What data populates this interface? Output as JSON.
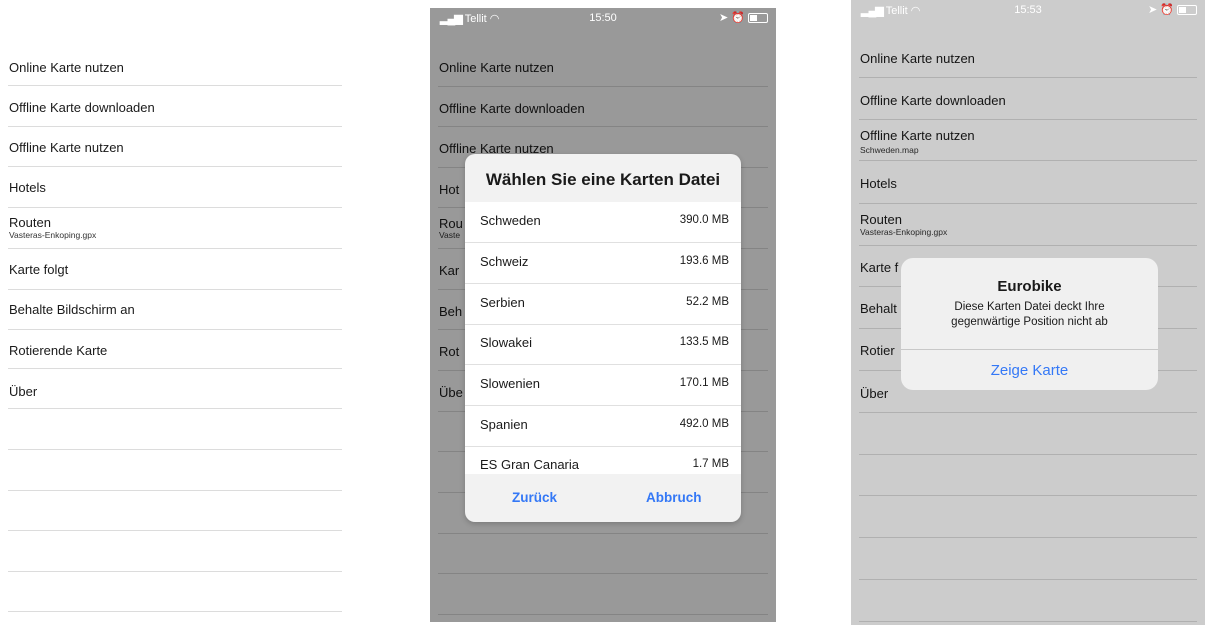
{
  "screen1": {
    "menu": [
      {
        "label": "Online Karte nutzen",
        "sub": ""
      },
      {
        "label": "Offline Karte downloaden",
        "sub": ""
      },
      {
        "label": "Offline Karte nutzen",
        "sub": ""
      },
      {
        "label": "Hotels",
        "sub": ""
      },
      {
        "label": "Routen",
        "sub": "Vasteras-Enkoping.gpx"
      },
      {
        "label": "Karte folgt",
        "sub": ""
      },
      {
        "label": "Behalte Bildschirm an",
        "sub": ""
      },
      {
        "label": "Rotierende Karte",
        "sub": ""
      },
      {
        "label": "Über",
        "sub": ""
      }
    ]
  },
  "screen2": {
    "status": {
      "carrier": "Tellit",
      "time": "15:50"
    },
    "menu": [
      {
        "label": "Online Karte nutzen",
        "sub": ""
      },
      {
        "label": "Offline Karte downloaden",
        "sub": ""
      },
      {
        "label": "Offline Karte nutzen",
        "sub": ""
      },
      {
        "label": "Hot",
        "sub": ""
      },
      {
        "label": "Rou",
        "sub": "Vaste"
      },
      {
        "label": "Kar",
        "sub": ""
      },
      {
        "label": "Beh",
        "sub": ""
      },
      {
        "label": "Rot",
        "sub": ""
      },
      {
        "label": "Übe",
        "sub": ""
      }
    ],
    "picker": {
      "title": "Wählen Sie eine Karten Datei",
      "items": [
        {
          "name": "Schweden",
          "size": "390.0 MB"
        },
        {
          "name": "Schweiz",
          "size": "193.6 MB"
        },
        {
          "name": "Serbien",
          "size": "52.2 MB"
        },
        {
          "name": "Slowakei",
          "size": "133.5 MB"
        },
        {
          "name": "Slowenien",
          "size": "170.1 MB"
        },
        {
          "name": "Spanien",
          "size": "492.0 MB"
        },
        {
          "name": "ES Gran Canaria",
          "size": "1.7 MB"
        }
      ],
      "back_label": "Zurück",
      "cancel_label": "Abbruch"
    }
  },
  "screen3": {
    "status": {
      "carrier": "Tellit",
      "time": "15:53"
    },
    "menu": [
      {
        "label": "Online Karte nutzen",
        "sub": ""
      },
      {
        "label": "Offline Karte downloaden",
        "sub": ""
      },
      {
        "label": "Offline Karte nutzen",
        "sub": "Schweden.map"
      },
      {
        "label": "Hotels",
        "sub": ""
      },
      {
        "label": "Routen",
        "sub": "Vasteras-Enkoping.gpx"
      },
      {
        "label": "Karte f",
        "sub": ""
      },
      {
        "label": "Behalt",
        "sub": ""
      },
      {
        "label": "Rotier",
        "sub": ""
      },
      {
        "label": "Über",
        "sub": ""
      }
    ],
    "alert": {
      "title": "Eurobike",
      "message_line1": "Diese Karten Datei deckt Ihre",
      "message_line2": "gegenwärtige Position nicht ab",
      "button": "Zeige Karte"
    }
  },
  "colors": {
    "accent": "#3478f6",
    "separator": "#dcdcdc",
    "overlay": "rgba(0,0,0,0.40)"
  }
}
